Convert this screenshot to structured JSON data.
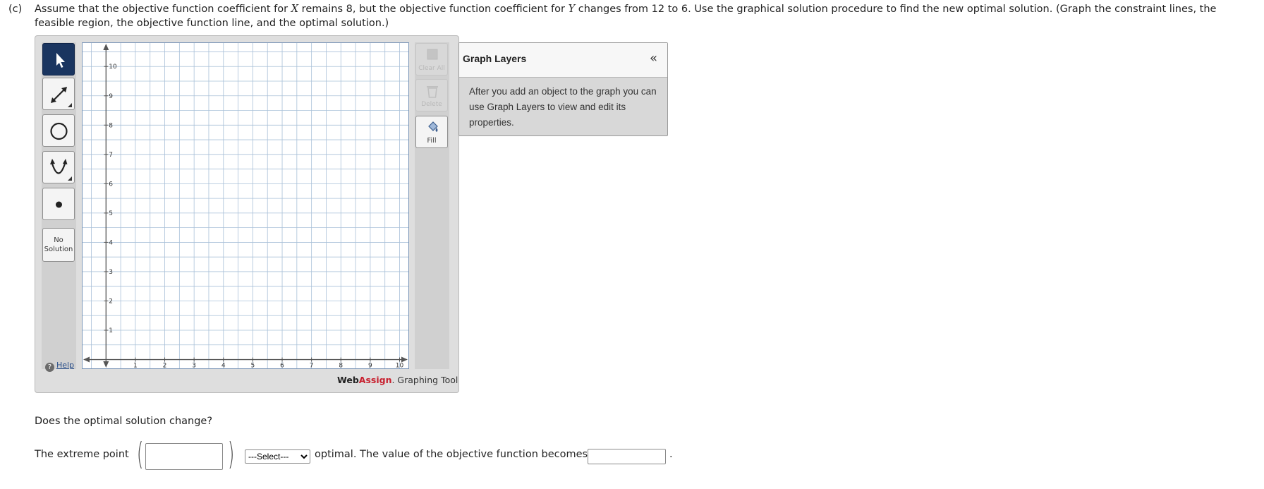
{
  "question": {
    "label": "(c)",
    "text_part1": "Assume that the objective function coefficient for ",
    "var_x": "X",
    "text_part2": " remains 8, but the objective function coefficient for ",
    "var_y": "Y",
    "text_part3": " changes from 12 to 6. Use the graphical solution procedure to find the new optimal solution. (Graph the constraint lines, the feasible region, the objective function line, and the optimal solution.)"
  },
  "tools": [
    {
      "name": "pointer-tool",
      "icon": "arrow-pointer-icon"
    },
    {
      "name": "line-tool",
      "icon": "line-segment-icon"
    },
    {
      "name": "circle-tool",
      "icon": "circle-icon"
    },
    {
      "name": "parabola-tool",
      "icon": "parabola-icon"
    },
    {
      "name": "point-tool",
      "icon": "point-icon"
    }
  ],
  "no_solution_label_1": "No",
  "no_solution_label_2": "Solution",
  "help_label": "Help",
  "help_icon": "?",
  "side_buttons": {
    "clear_all": "Clear All",
    "delete": "Delete",
    "fill": "Fill"
  },
  "graph": {
    "x_ticks": [
      "1",
      "2",
      "3",
      "4",
      "5",
      "6",
      "7",
      "8",
      "9",
      "10"
    ],
    "y_ticks": [
      "1",
      "2",
      "3",
      "4",
      "5",
      "6",
      "7",
      "8",
      "9",
      "10"
    ],
    "x_range": [
      -0.8,
      10.3
    ],
    "y_range": [
      -0.3,
      10.8
    ],
    "grid_color": "#a9c0d8",
    "axis_color": "#555555"
  },
  "brand": {
    "web": "Web",
    "assign": "Assign",
    "suffix": ". Graphing Tool"
  },
  "layers": {
    "title": "Graph Layers",
    "collapse": "«",
    "body": "After you add an object to the graph you can use Graph Layers to view and edit its properties."
  },
  "question2": "Does the optimal solution change?",
  "answer_row": {
    "text1": "The extreme point",
    "open_paren": "(",
    "close_paren": ")",
    "point_value": "",
    "select_value": "---Select---",
    "select_options": [
      "---Select---"
    ],
    "text2": "optimal. The value of the objective function becomes",
    "objective_value": "",
    "end": "."
  }
}
